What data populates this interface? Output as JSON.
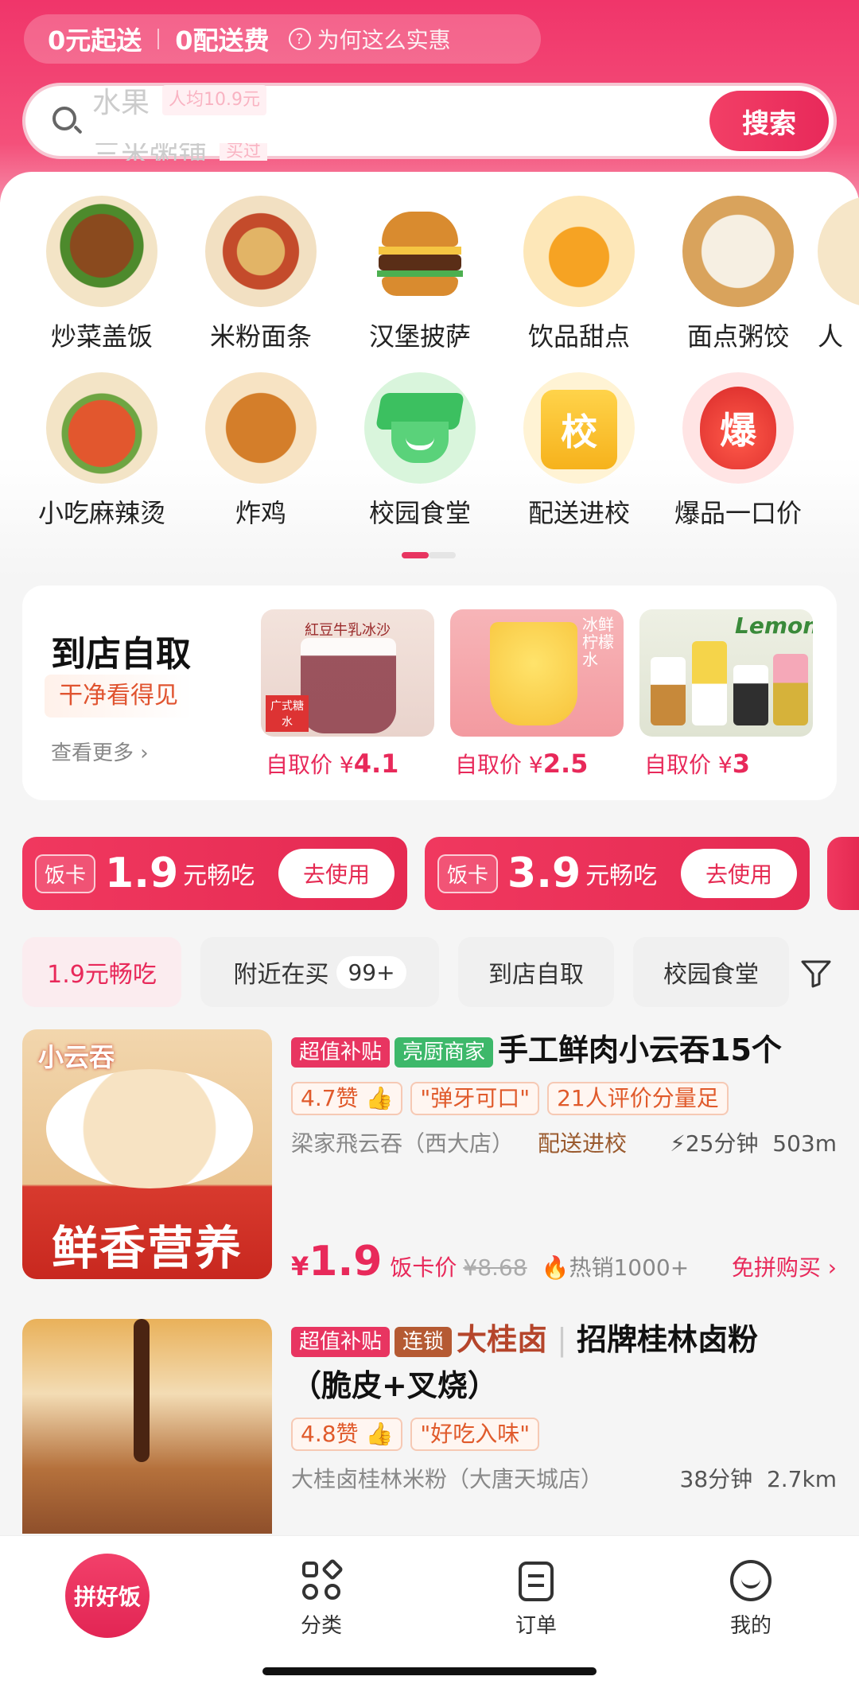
{
  "promo": {
    "free_start": "0元起送",
    "free_delivery": "0配送费",
    "why": "为何这么实惠"
  },
  "search": {
    "hint_top": "水果",
    "hint_top_tag": "人均10.9元",
    "hint_bottom": "三米粥铺",
    "hint_bottom_tag": "买过",
    "button": "搜索"
  },
  "categories": [
    {
      "label": "炒菜盖饭",
      "icon": "stir-fry-rice"
    },
    {
      "label": "米粉面条",
      "icon": "noodles"
    },
    {
      "label": "汉堡披萨",
      "icon": "burger"
    },
    {
      "label": "饮品甜点",
      "icon": "drink"
    },
    {
      "label": "面点粥饺",
      "icon": "dumplings"
    },
    {
      "label": "人",
      "icon": "partial"
    },
    {
      "label": "小吃麻辣烫",
      "icon": "malatang"
    },
    {
      "label": "炸鸡",
      "icon": "fried-chicken"
    },
    {
      "label": "校园食堂",
      "icon": "graduation-cap"
    },
    {
      "label": "配送进校",
      "icon": "campus-bag"
    },
    {
      "label": "爆品一口价",
      "icon": "hot-deal"
    }
  ],
  "campus_bag_char": "校",
  "hot_deal_char": "爆",
  "pickup": {
    "title": "到店自取",
    "subtitle": "干净看得见",
    "more": "查看更多",
    "items": [
      {
        "price_label": "自取价 ¥",
        "price": "4.1",
        "img_text": "紅豆牛乳冰沙",
        "badge": "广式糖水"
      },
      {
        "price_label": "自取价 ¥",
        "price": "2.5",
        "img_text": "冰鲜柠檬水"
      },
      {
        "price_label": "自取价 ¥",
        "price": "3",
        "img_text": "Lemon"
      }
    ]
  },
  "fan_cards": [
    {
      "tag": "饭卡",
      "amount": "1.9",
      "unit": "元畅吃",
      "button": "去使用"
    },
    {
      "tag": "饭卡",
      "amount": "3.9",
      "unit": "元畅吃",
      "button": "去使用"
    }
  ],
  "filters": [
    {
      "label": "1.9元畅吃",
      "active": true
    },
    {
      "label": "附近在买",
      "badge": "99+"
    },
    {
      "label": "到店自取"
    },
    {
      "label": "校园食堂"
    }
  ],
  "foods": [
    {
      "tags": [
        "超值补贴",
        "亮厨商家"
      ],
      "title": "手工鲜肉小云吞15个",
      "chips": [
        "4.7赞",
        "\"弹牙可口\"",
        "21人评价分量足"
      ],
      "shop": "梁家飛云吞（西大店）",
      "delivery": "配送进校",
      "time": "25分钟",
      "distance": "503m",
      "img_top": "小云吞",
      "img_bottom": "鲜香营养",
      "price": "1.9",
      "price_label": "饭卡价",
      "orig": "¥8.68",
      "hot": "热销1000+",
      "buy": "免拼购买"
    },
    {
      "tags": [
        "超值补贴",
        "连锁"
      ],
      "brand": "大桂卤",
      "title": "招牌桂林卤粉",
      "title2": "（脆皮+叉烧）",
      "chips": [
        "4.8赞",
        "\"好吃入味\""
      ],
      "shop": "大桂卤桂林米粉（大唐天城店）",
      "time": "38分钟",
      "distance": "2.7km"
    }
  ],
  "tabbar": {
    "main": "拼好饭",
    "category": "分类",
    "orders": "订单",
    "mine": "我的"
  }
}
